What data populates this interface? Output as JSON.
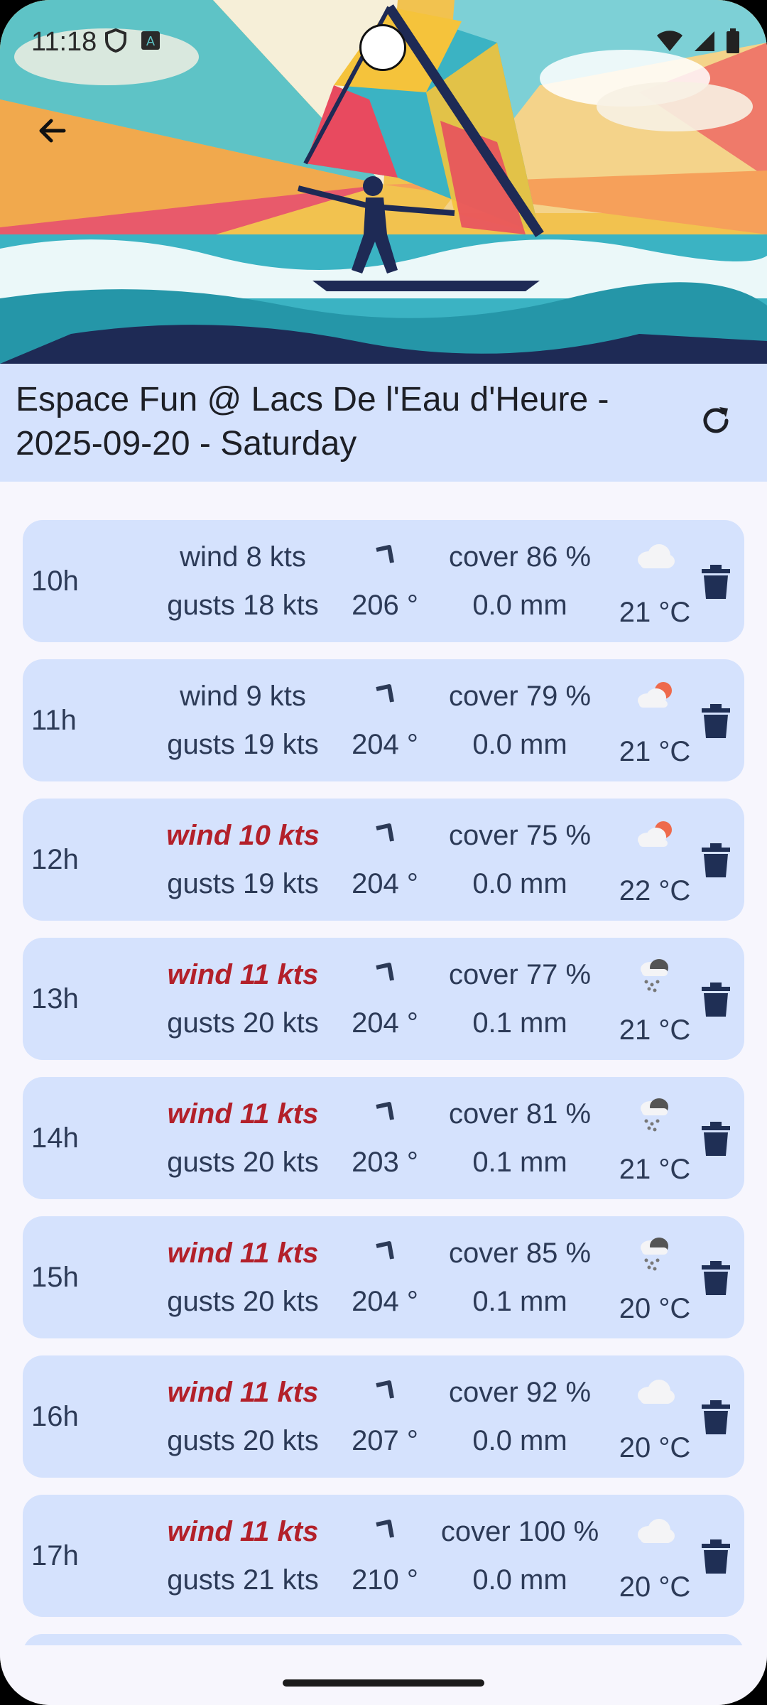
{
  "status_bar": {
    "time": "11:18",
    "left_icons": [
      "shield-icon",
      "keyboard-a-icon"
    ],
    "right_icons": [
      "wifi-icon",
      "signal-icon",
      "battery-icon"
    ]
  },
  "header": {
    "back_icon": "arrow-left-icon",
    "title": "Espace Fun @ Lacs De l'Eau d'Heure - 2025-09-20 - Saturday",
    "refresh_icon": "refresh-icon",
    "background_color": "#d5e2fd"
  },
  "colors": {
    "row_background": "#d5e2fd",
    "text": "#2c3a57",
    "strong_wind": "#b3202a",
    "page_background": "#f7f6fd"
  },
  "forecast": [
    {
      "hour": "10h",
      "wind": "wind 8 kts",
      "strong": false,
      "gusts": "gusts 18 kts",
      "direction": "206 °",
      "cover": "cover 86 %",
      "rain": "0.0 mm",
      "weather_icon": "cloud-icon",
      "temp": "21 °C"
    },
    {
      "hour": "11h",
      "wind": "wind 9 kts",
      "strong": false,
      "gusts": "gusts 19 kts",
      "direction": "204 °",
      "cover": "cover 79 %",
      "rain": "0.0 mm",
      "weather_icon": "partly-cloudy-icon",
      "temp": "21 °C"
    },
    {
      "hour": "12h",
      "wind": "wind 10 kts",
      "strong": true,
      "gusts": "gusts 19 kts",
      "direction": "204 °",
      "cover": "cover 75 %",
      "rain": "0.0 mm",
      "weather_icon": "partly-cloudy-icon",
      "temp": "22 °C"
    },
    {
      "hour": "13h",
      "wind": "wind 11 kts",
      "strong": true,
      "gusts": "gusts 20 kts",
      "direction": "204 °",
      "cover": "cover 77 %",
      "rain": "0.1 mm",
      "weather_icon": "rain-cloud-icon",
      "temp": "21 °C"
    },
    {
      "hour": "14h",
      "wind": "wind 11 kts",
      "strong": true,
      "gusts": "gusts 20 kts",
      "direction": "203 °",
      "cover": "cover 81 %",
      "rain": "0.1 mm",
      "weather_icon": "rain-cloud-icon",
      "temp": "21 °C"
    },
    {
      "hour": "15h",
      "wind": "wind 11 kts",
      "strong": true,
      "gusts": "gusts 20 kts",
      "direction": "204 °",
      "cover": "cover 85 %",
      "rain": "0.1 mm",
      "weather_icon": "rain-cloud-icon",
      "temp": "20 °C"
    },
    {
      "hour": "16h",
      "wind": "wind 11 kts",
      "strong": true,
      "gusts": "gusts 20 kts",
      "direction": "207 °",
      "cover": "cover 92 %",
      "rain": "0.0 mm",
      "weather_icon": "cloud-icon",
      "temp": "20 °C"
    },
    {
      "hour": "17h",
      "wind": "wind 11 kts",
      "strong": true,
      "gusts": "gusts 21 kts",
      "direction": "210 °",
      "cover": "cover 100 %",
      "rain": "0.0 mm",
      "weather_icon": "cloud-icon",
      "temp": "20 °C"
    }
  ]
}
